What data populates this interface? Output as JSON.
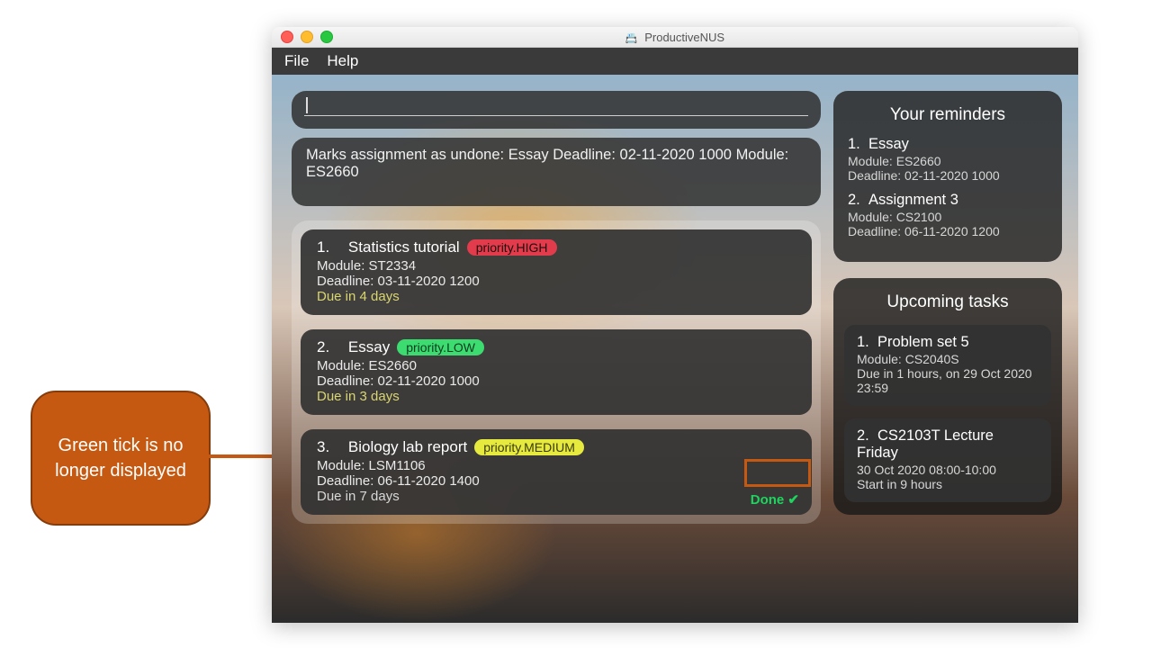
{
  "callout_text": "Green tick is no longer displayed",
  "window": {
    "title": "ProductiveNUS"
  },
  "menubar": {
    "file": "File",
    "help": "Help"
  },
  "status_message": "Marks assignment as undone: Essay Deadline: 02-11-2020 1000 Module: ES2660",
  "tasks": [
    {
      "idx": "1.",
      "name": "Statistics tutorial",
      "priority_label": "priority.HIGH",
      "priority_class": "high",
      "module": "Module: ST2334",
      "deadline": "Deadline: 03-11-2020 1200",
      "due": "Due in 4 days",
      "due_class": "soon",
      "done": false
    },
    {
      "idx": "2.",
      "name": "Essay",
      "priority_label": "priority.LOW",
      "priority_class": "low",
      "module": "Module: ES2660",
      "deadline": "Deadline: 02-11-2020 1000",
      "due": "Due in 3 days",
      "due_class": "soon",
      "done": false
    },
    {
      "idx": "3.",
      "name": "Biology lab report",
      "priority_label": "priority.MEDIUM",
      "priority_class": "med",
      "module": "Module: LSM1106",
      "deadline": "Deadline: 06-11-2020 1400",
      "due": "Due in 7 days",
      "due_class": "normal",
      "done": true,
      "done_label": "Done ✔"
    }
  ],
  "reminders": {
    "title": "Your reminders",
    "items": [
      {
        "idx": "1.",
        "name": "Essay",
        "module": "Module: ES2660",
        "deadline": "Deadline: 02-11-2020 1000"
      },
      {
        "idx": "2.",
        "name": "Assignment 3",
        "module": "Module: CS2100",
        "deadline": "Deadline: 06-11-2020 1200"
      }
    ]
  },
  "upcoming": {
    "title": "Upcoming tasks",
    "items": [
      {
        "idx": "1.",
        "name": "Problem set 5",
        "line1": "Module: CS2040S",
        "line2": "Due in 1 hours, on 29 Oct 2020 23:59",
        "line2_class": "urgent"
      },
      {
        "idx": "2.",
        "name": "CS2103T Lecture Friday",
        "line1": "30 Oct 2020 08:00-10:00",
        "line2": "Start in 9 hours",
        "line2_class": "urgent"
      }
    ]
  }
}
